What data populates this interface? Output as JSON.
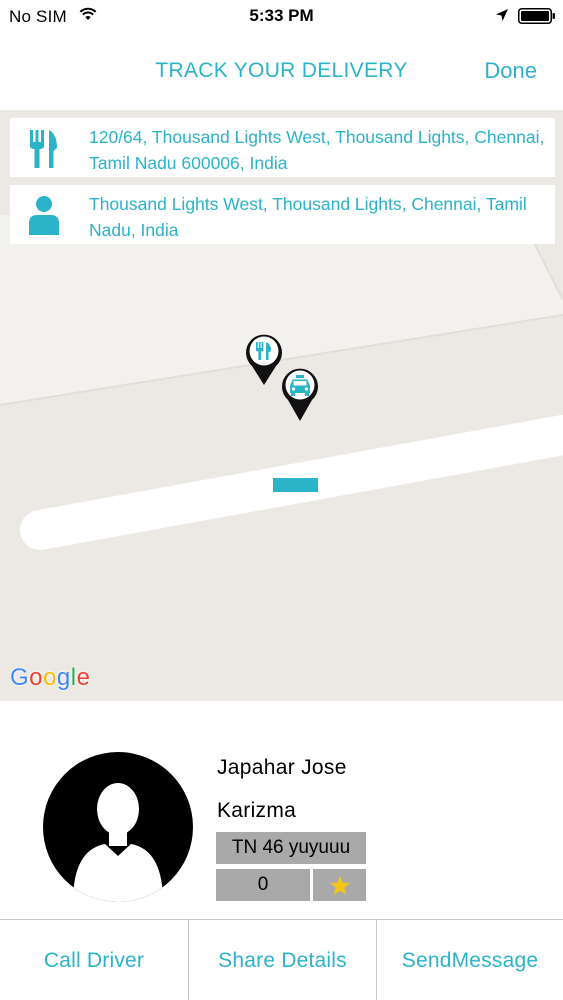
{
  "status_bar": {
    "carrier": "No SIM",
    "time": "5:33 PM"
  },
  "nav": {
    "title": "TRACK YOUR DELIVERY",
    "done_label": "Done"
  },
  "addresses": {
    "pickup": {
      "icon": "fork-knife-icon",
      "text": "120/64, Thousand Lights West, Thousand Lights, Chennai, Tamil Nadu 600006, India"
    },
    "dropoff": {
      "icon": "person-icon",
      "text": "Thousand Lights West, Thousand Lights, Chennai, Tamil Nadu, India"
    }
  },
  "map": {
    "markers": [
      "restaurant-pin-icon",
      "taxi-pin-icon"
    ],
    "attribution_letters": [
      "G",
      "o",
      "o",
      "g",
      "l",
      "e"
    ]
  },
  "driver": {
    "name": "Japahar Jose",
    "vehicle": "Karizma",
    "plate": "TN 46 yuyuuu",
    "rating_count": "0"
  },
  "actions": {
    "call": "Call Driver",
    "share": "Share Details",
    "send": "SendMessage"
  },
  "colors": {
    "accent": "#2bb3c9",
    "map_land": "#ece9e4",
    "badge_grey": "#a9a9a9",
    "star": "#f5c518"
  }
}
